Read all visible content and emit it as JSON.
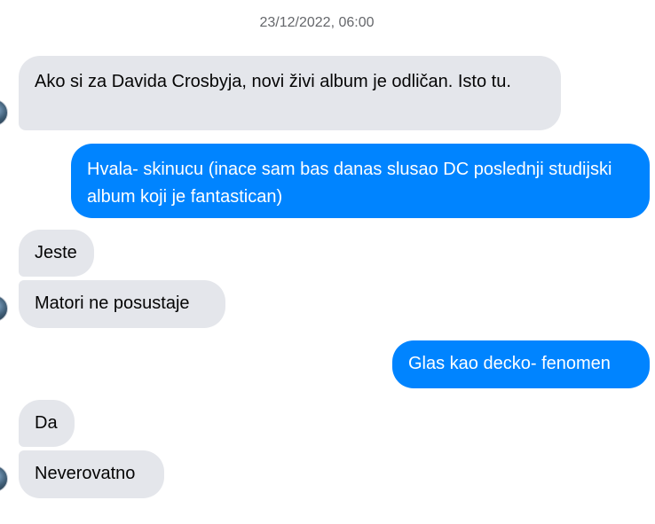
{
  "conversation": {
    "timestamp": "23/12/2022, 06:00",
    "messages": [
      {
        "direction": "incoming",
        "text": "Ako si za Davida Crosbyja, novi živi album je odličan. Isto tu."
      },
      {
        "direction": "outgoing",
        "text": "Hvala- skinucu (inace sam bas danas slusao DC poslednji studijski album koji je fantastican)"
      },
      {
        "direction": "incoming",
        "text": "Jeste"
      },
      {
        "direction": "incoming",
        "text": "Matori ne posustaje"
      },
      {
        "direction": "outgoing",
        "text": "Glas kao decko- fenomen"
      },
      {
        "direction": "incoming",
        "text": "Da"
      },
      {
        "direction": "incoming",
        "text": "Neverovatno"
      }
    ]
  },
  "colors": {
    "incoming_bubble": "#e4e6eb",
    "outgoing_bubble": "#0084ff",
    "timestamp_text": "#65676b"
  },
  "icons": {
    "avatar": "contact-avatar"
  }
}
